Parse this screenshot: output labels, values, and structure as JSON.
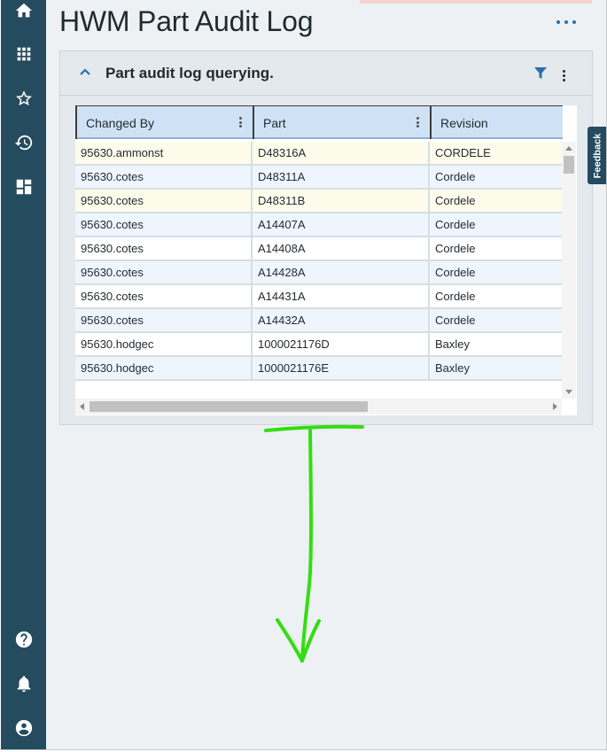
{
  "page": {
    "title": "HWM Part Audit Log"
  },
  "nav": {
    "items": [
      {
        "name": "home",
        "icon": "home-icon"
      },
      {
        "name": "apps",
        "icon": "grid-apps-icon"
      },
      {
        "name": "favorites",
        "icon": "star-icon"
      },
      {
        "name": "history",
        "icon": "history-icon"
      },
      {
        "name": "dashboards",
        "icon": "dashboard-icon"
      },
      {
        "name": "help",
        "icon": "help-icon"
      },
      {
        "name": "notifications",
        "icon": "bell-icon"
      },
      {
        "name": "account",
        "icon": "account-icon"
      }
    ]
  },
  "card": {
    "title": "Part audit log querying."
  },
  "grid": {
    "columns": [
      "Changed By",
      "Part",
      "Revision"
    ],
    "rows": [
      [
        "95630.ammonst",
        "D48316A",
        "CORDELE"
      ],
      [
        "95630.cotes",
        "D48311A",
        "Cordele"
      ],
      [
        "95630.cotes",
        "D48311B",
        "Cordele"
      ],
      [
        "95630.cotes",
        "A14407A",
        "Cordele"
      ],
      [
        "95630.cotes",
        "A14408A",
        "Cordele"
      ],
      [
        "95630.cotes",
        "A14428A",
        "Cordele"
      ],
      [
        "95630.cotes",
        "A14431A",
        "Cordele"
      ],
      [
        "95630.cotes",
        "A14432A",
        "Cordele"
      ],
      [
        "95630.hodgec",
        "1000021176D",
        "Baxley"
      ],
      [
        "95630.hodgec",
        "1000021176E",
        "Baxley"
      ]
    ]
  },
  "feedback": {
    "label": "Feedback"
  },
  "colors": {
    "rail": "#244b5e",
    "accent": "#2f6ea8",
    "header_bg": "#cfe2f5",
    "annotation": "#33dd11"
  }
}
